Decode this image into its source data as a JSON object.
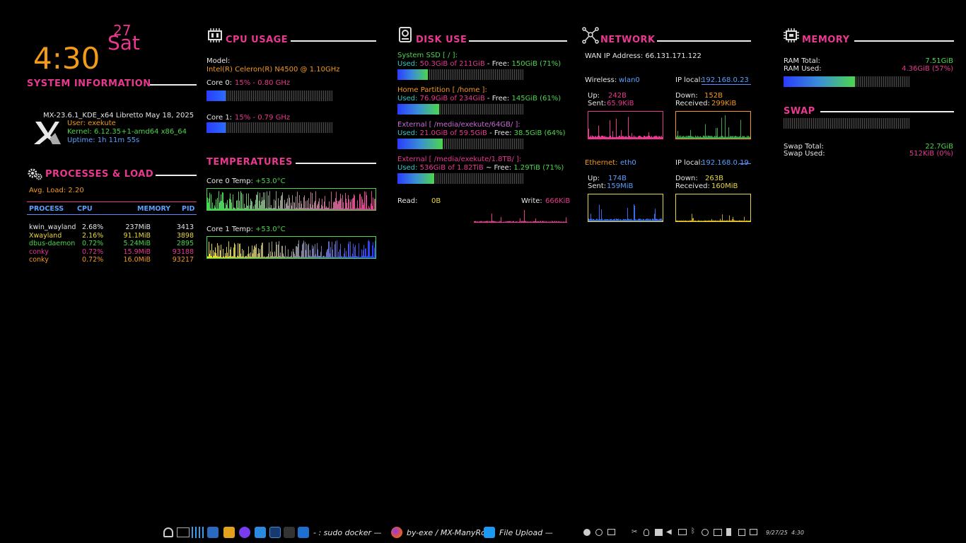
{
  "clock": {
    "time": "4:30",
    "day": "27",
    "weekday": "Sat"
  },
  "sysinfo": {
    "title": "SYSTEM INFORMATION",
    "distro": "MX-23.6.1_KDE_x64 Libretto May 18, 2025",
    "user": "User: exekute",
    "kernel": "Kernel: 6.12.35+1-amd64 x86_64",
    "uptime": "Uptime: 1h 11m 55s"
  },
  "processes": {
    "title": "PROCESSES & LOAD",
    "avg_load": "Avg. Load: 2.20",
    "headers": {
      "process": "PROCESS",
      "cpu": "CPU",
      "memory": "MEMORY",
      "pid": "PID"
    },
    "rows": [
      {
        "name": "kwin_wayland",
        "cpu": "2.68%",
        "mem": "237MiB",
        "pid": "3413",
        "color": "#e6e6e6"
      },
      {
        "name": "Xwayland",
        "cpu": "2.16%",
        "mem": "91.1MiB",
        "pid": "3898",
        "color": "#e9d83a"
      },
      {
        "name": "dbus-daemon",
        "cpu": "0.72%",
        "mem": "5.24MiB",
        "pid": "2895",
        "color": "#4cd64c"
      },
      {
        "name": "conky",
        "cpu": "0.72%",
        "mem": "15.9MiB",
        "pid": "93188",
        "color": "#e8388f"
      },
      {
        "name": "conky",
        "cpu": "0.72%",
        "mem": "16.0MiB",
        "pid": "93217",
        "color": "#f29a1a"
      }
    ]
  },
  "cpu": {
    "title": "CPU USAGE",
    "model_label": "Model:",
    "model": "Intel(R) Celeron(R) N4500 @ 1.10GHz",
    "core0": {
      "label": "Core 0:",
      "value": "15% - 0.80 GHz",
      "usage": 0.15
    },
    "core1": {
      "label": "Core 1:",
      "value": "15% - 0.79 GHz",
      "usage": 0.15
    }
  },
  "temps": {
    "title": "TEMPERATURES",
    "core0_label": "Core 0 Temp:",
    "core0": "+53.0°C",
    "core1_label": "Core 1 Temp:",
    "core1": "+53.0°C"
  },
  "disk": {
    "title": "DISK USE",
    "entries": [
      {
        "name": "System SSD [ / ]:",
        "used_label": "Used:",
        "used": "50.3GiB of 211GiB",
        "free_label": "- Free:",
        "free": "150GiB (71%)",
        "usage": 0.24,
        "color": "#4cd64c"
      },
      {
        "name": "Home Partition [ /home ]:",
        "used_label": "Used:",
        "used": "76.9GiB of 234GiB",
        "free_label": "- Free:",
        "free": "145GiB (61%)",
        "usage": 0.33,
        "color": "#f29a1a"
      },
      {
        "name": "External [ /media/exekute/64GB/ ]:",
        "used_label": "Used:",
        "used": "21.0GiB of 59.5GiB",
        "free_label": "- Free:",
        "free": "38.5GiB (64%)",
        "usage": 0.36,
        "color": "#c86bd6"
      },
      {
        "name": "External [ /media/exekute/1.8TB/ ]:",
        "used_label": "Used:",
        "used": "536GiB of 1.82TiB",
        "free_label": "~ Free:",
        "free": "1.29TiB (71%)",
        "usage": 0.29,
        "color": "#e8388f"
      }
    ],
    "read_label": "Read:",
    "read": "0B",
    "write_label": "Write:",
    "write": "666KiB"
  },
  "network": {
    "title": "NETWORK",
    "wan": "WAN IP Address: 66.131.171.122",
    "wireless_label": "Wireless:",
    "wireless_if": "wlan0",
    "wireless_ip_label": "IP local:",
    "wireless_ip": "192.168.0.23",
    "w_up_label": "Up:",
    "w_up": "242B",
    "w_sent_label": "Sent:",
    "w_sent": "65.9KiB",
    "w_down_label": "Down:",
    "w_down": "152B",
    "w_recv_label": "Received:",
    "w_recv": "299KiB",
    "ethernet_label": "Ethernet:",
    "ethernet_if": "eth0",
    "eth_ip_label": "IP local:",
    "eth_ip": "192.168.0.19",
    "e_up_label": "Up:",
    "e_up": "174B",
    "e_sent_label": "Sent:",
    "e_sent": "159MiB",
    "e_down_label": "Down:",
    "e_down": "263B",
    "e_recv_label": "Received:",
    "e_recv": "160MiB"
  },
  "memory": {
    "title": "MEMORY",
    "ram_total_label": "RAM Total:",
    "ram_total": "7.51GiB",
    "ram_used_label": "RAM Used:",
    "ram_used": "4.36GiB (57%)",
    "ram_usage": 0.57,
    "swap_title": "SWAP",
    "swap_total_label": "Swap Total:",
    "swap_total": "22.7GiB",
    "swap_used_label": "Swap Used:",
    "swap_used": "512KiB (0%)",
    "swap_usage": 0.0
  },
  "taskbar": {
    "task1": "- : sudo docker —",
    "task2": "by-exe / MX-ManyRo",
    "task3": "File Upload —",
    "date": "9/27/25",
    "time": "4:30"
  },
  "colors": {
    "accent": "#e8388f",
    "background": "#000000"
  }
}
